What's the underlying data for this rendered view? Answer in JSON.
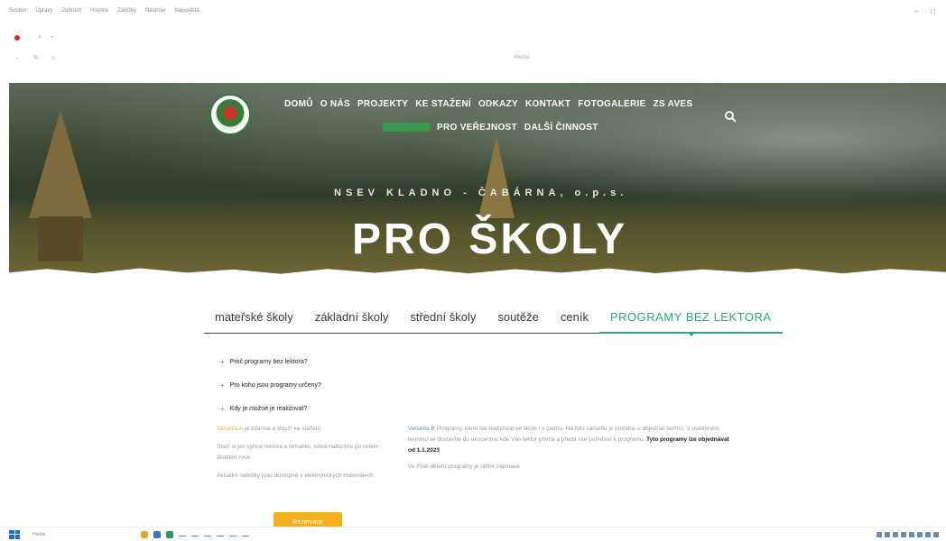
{
  "browser": {
    "menu": [
      "Soubor",
      "Úpravy",
      "Zobrazit",
      "Historie",
      "Záložky",
      "Nástroje",
      "Nápověda"
    ],
    "tab_label": "",
    "url": "",
    "search_placeholder": "Hledat",
    "bookmarks": [
      "",
      "",
      "",
      ""
    ]
  },
  "header": {
    "nav_row1": [
      "DOMŮ",
      "O NÁS",
      "PROJEKTY",
      "KE STAŽENÍ",
      "ODKAZY",
      "KONTAKT",
      "FOTOGALERIE",
      "ZS AVES"
    ],
    "nav_row2": [
      "PRO VEŘEJNOST",
      "DALŠÍ ČINNOST"
    ],
    "subtitle": "NSEV KLADNO - ČABÁRNA, o.p.s.",
    "title": "PRO ŠKOLY"
  },
  "tabs": [
    "mateřské školy",
    "základní školy",
    "střední školy",
    "soutěže",
    "ceník",
    "PROGRAMY BEZ LEKTORA"
  ],
  "faq": [
    "Proč programy bez lektora?",
    "Pro koho jsou programy určeny?",
    "Kdy je možné je realizovat?"
  ],
  "content": {
    "left_hl": "Varianta A",
    "left_p1": "je zdarma a slouží ke stažení.",
    "left_p2": "Stačí si jen vybrat lektora a tematiku, která nabízíme po celém školním roce.",
    "left_p3": "Aktuální nabídky jsou dostupné v elektronických materiálech.",
    "right_hl": "Varianta B",
    "right_p1": "Programy, které lze realizovat ve škole i v centru. Na tuto variantu je potřeba si objednat termín. V uvedeném termínu se dostavíte do ekocentra, kde Vás lektor přivítá a předá vše potřebné k programu.",
    "right_bold": "Tyto programy lze objednávat od 1.1.2023",
    "right_p2": "Ve třídě dětem programy je úplně zajímavé",
    "cta": "Rezervace"
  },
  "taskbar": {
    "search": "Hledat",
    "apps": [
      "",
      "",
      "",
      "",
      "",
      ""
    ]
  }
}
